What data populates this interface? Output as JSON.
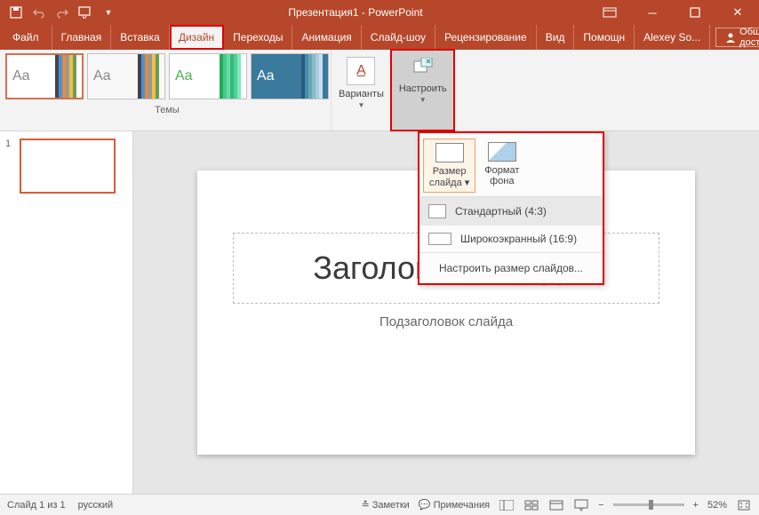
{
  "title": "Презентация1 - PowerPoint",
  "tabs": {
    "file": "Файл",
    "home": "Главная",
    "insert": "Вставка",
    "design": "Дизайн",
    "transitions": "Переходы",
    "animation": "Анимация",
    "slideshow": "Слайд-шоу",
    "review": "Рецензирование",
    "view": "Вид",
    "help": "Помощн",
    "user": "Alexey So...",
    "share": "Общий доступ"
  },
  "ribbon": {
    "themes_label": "Темы",
    "variants_label": "Варианты",
    "customize_label": "Настроить"
  },
  "dropdown": {
    "size_btn": "Размер",
    "size_btn2": "слайда",
    "format_btn": "Формат",
    "format_btn2": "фона",
    "opt_standard": "Стандартный (4:3)",
    "opt_wide": "Широкоэкранный (16:9)",
    "opt_custom": "Настроить размер слайдов..."
  },
  "slide": {
    "num": "1",
    "title": "Заголовок слайда",
    "subtitle": "Подзаголовок слайда"
  },
  "status": {
    "slide": "Слайд 1 из 1",
    "lang": "русский",
    "notes": "Заметки",
    "comments": "Примечания",
    "zoom": "52%"
  }
}
